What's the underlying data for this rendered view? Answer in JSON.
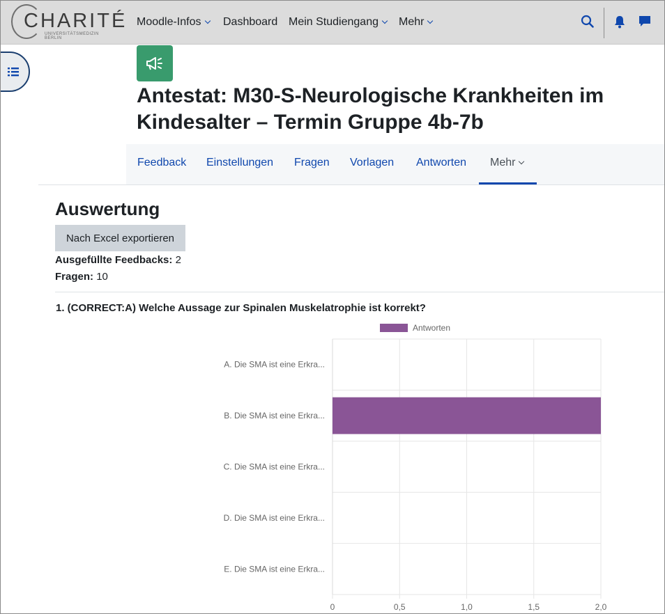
{
  "navbar": {
    "logo_text": "CHARITÉ",
    "logo_subtext": "UNIVERSITÄTSMEDIZIN BERLIN",
    "items": [
      {
        "label": "Moodle-Infos",
        "dropdown": true
      },
      {
        "label": "Dashboard",
        "dropdown": false
      },
      {
        "label": "Mein Studiengang",
        "dropdown": true
      },
      {
        "label": "Mehr",
        "dropdown": true
      }
    ],
    "icons": [
      "search-icon",
      "bell-icon",
      "chat-icon"
    ],
    "accent": "#0f47ad",
    "background": "#dcdcdc"
  },
  "drawer_toggle_icon": "list-icon",
  "activity": {
    "icon": "megaphone-icon",
    "icon_color": "#399b6d",
    "title": "Antestat: M30-S-Neurologische Krankheiten im Kindesalter – Termin Gruppe 4b-7b"
  },
  "secondary_nav": {
    "items": [
      {
        "label": "Feedback"
      },
      {
        "label": "Einstellungen"
      },
      {
        "label": "Fragen"
      },
      {
        "label": "Vorlagen"
      },
      {
        "label": "Antworten"
      },
      {
        "label": "Mehr",
        "active": true,
        "dropdown": true
      }
    ]
  },
  "content": {
    "heading": "Auswertung",
    "export_button": "Nach Excel exportieren",
    "filled_label": "Ausgefüllte Feedbacks:",
    "filled_value": "2",
    "questions_label": "Fragen:",
    "questions_value": "10",
    "question_title": "1. (CORRECT:A) Welche Aussage zur Spinalen Muskelatrophie ist korrekt?"
  },
  "chart_data": {
    "type": "bar",
    "orientation": "horizontal",
    "categories": [
      "A. Die SMA ist eine Erkra...",
      "B. Die SMA ist eine Erkra...",
      "C. Die SMA ist eine Erkra...",
      "D. Die SMA ist eine Erkra...",
      "E. Die SMA ist eine Erkra..."
    ],
    "series": [
      {
        "name": "Antworten",
        "values": [
          0,
          2,
          0,
          0,
          0
        ],
        "color": "#8a5596"
      }
    ],
    "xlim": [
      0,
      2
    ],
    "xticks": [
      "0",
      "0,5",
      "1,0",
      "1,5",
      "2,0"
    ],
    "grid": true,
    "legend_position": "top"
  }
}
